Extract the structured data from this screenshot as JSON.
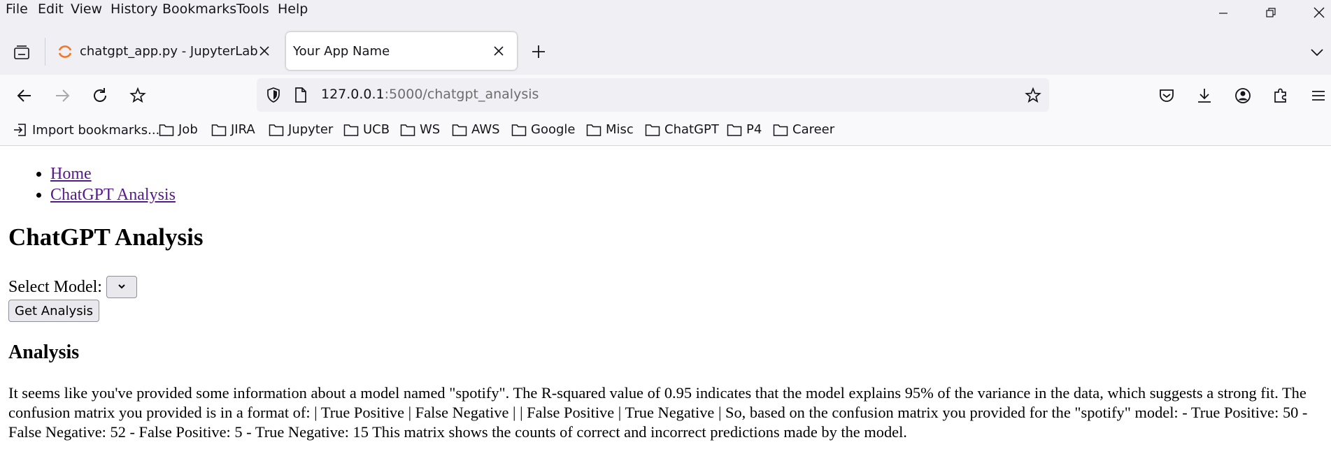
{
  "menu": {
    "file": "File",
    "edit": "Edit",
    "view": "View",
    "history": "History",
    "bookmarks": "Bookmarks",
    "tools": "Tools",
    "help": "Help"
  },
  "tabs": [
    {
      "title": "chatgpt_app.py - JupyterLab",
      "active": false
    },
    {
      "title": "Your App Name",
      "active": true
    }
  ],
  "address": {
    "host": "127.0.0.1",
    "path": ":5000/chatgpt_analysis"
  },
  "bookmarks": [
    "Import bookmarks...",
    "Job",
    "JIRA",
    "Jupyter",
    "UCB",
    "WS",
    "AWS",
    "Google",
    "Misc",
    "ChatGPT",
    "P4",
    "Career"
  ],
  "page": {
    "nav_links": [
      "Home",
      "ChatGPT Analysis"
    ],
    "heading": "ChatGPT Analysis",
    "select_label": "Select Model:",
    "button_label": "Get Analysis",
    "analysis_heading": "Analysis",
    "analysis_text": "It seems like you've provided some information about a model named \"spotify\". The R-squared value of 0.95 indicates that the model explains 95% of the variance in the data, which suggests a strong fit. The confusion matrix you provided is in a format of: | True Positive | False Negative | | False Positive | True Negative | So, based on the confusion matrix you provided for the \"spotify\" model: - True Positive: 50 - False Negative: 52 - False Positive: 5 - True Negative: 15 This matrix shows the counts of correct and incorrect predictions made by the model."
  },
  "colors": {
    "chrome_bg": "#f0f0f4",
    "toolbar_bg": "#f9f9fb",
    "visited_link": "#551a8b",
    "jupyter_orange": "#f37726"
  }
}
